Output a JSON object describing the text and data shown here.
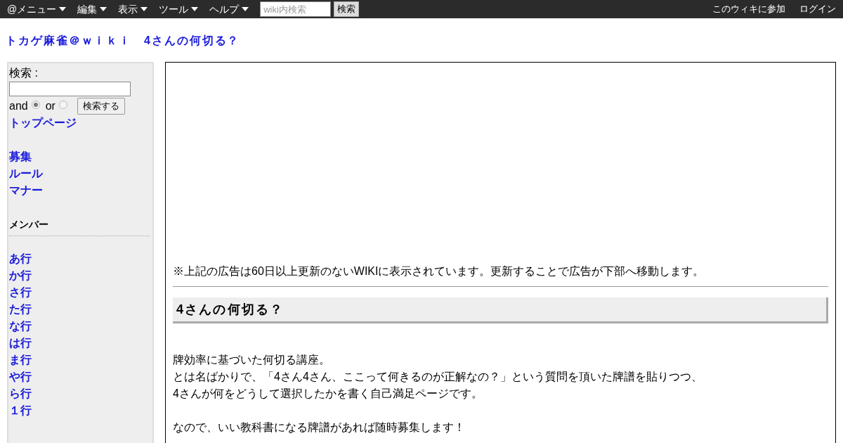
{
  "top_bar": {
    "menus": [
      "@メニュー",
      "編集",
      "表示",
      "ツール",
      "ヘルプ"
    ],
    "search": {
      "placeholder": "wiki内検索"
    },
    "search_button": "検索",
    "right_links": [
      "このウィキに参加",
      "ログイン"
    ]
  },
  "page_title": "トカゲ麻雀＠ｗｉｋｉ　4さんの何切る？",
  "sidebar": {
    "search_label": "検索 :",
    "options": [
      {
        "label": "and",
        "selected": true
      },
      {
        "label": "or",
        "selected": false
      }
    ],
    "search_button": "検索する",
    "top_link": "トップページ",
    "links": [
      "募集",
      "ルール",
      "マナー"
    ],
    "members_heading": "メンバー",
    "member_links": [
      "あ行",
      "か行",
      "さ行",
      "た行",
      "な行",
      "は行",
      "ま行",
      "や行",
      "ら行",
      "１行"
    ]
  },
  "main": {
    "notice": "※上記の広告は60日以上更新のないWIKIに表示されています。更新することで広告が下部へ移動します。",
    "heading": "4さんの何切る？",
    "paragraphs": [
      [
        "牌効率に基づいた何切る講座。",
        "とは名ばかりで、「4さん4さん、ここって何きるのが正解なの？」という質問を頂いた牌譜を貼りつつ、",
        "4さんが何をどうして選択したかを書く自己満足ページです。"
      ],
      [
        "なので、いい教科書になる牌譜があれば随時募集します！"
      ]
    ]
  }
}
